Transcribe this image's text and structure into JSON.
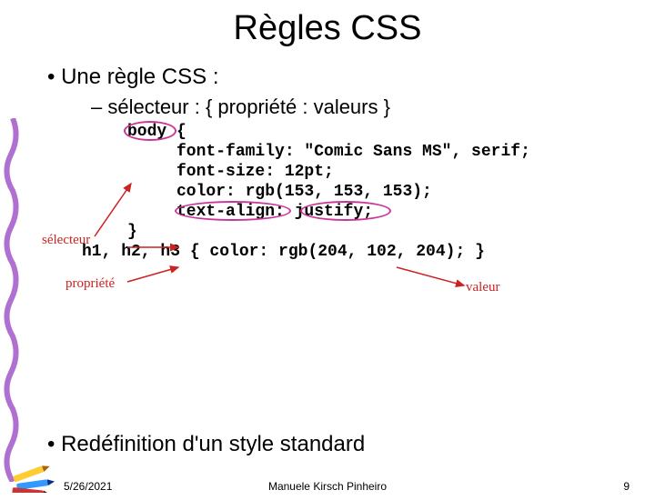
{
  "title": "Règles CSS",
  "bullets": {
    "b1": "• Une règle CSS :",
    "b2": "– sélecteur : { propriété : valeurs }",
    "b3": "• Redéfinition d'un style standard"
  },
  "code": {
    "l1": "body {",
    "l2": "     font-family: \"Comic Sans MS\", serif;",
    "l3": "     font-size: 12pt;",
    "l4": "     color: rgb(153, 153, 153);",
    "l5": "     text-align: justify;",
    "l6": "}",
    "l7": "h1, h2, h3 { color: rgb(204, 102, 204); }"
  },
  "labels": {
    "selector": "sélecteur",
    "property": "propriété",
    "value": "valeur"
  },
  "footer": {
    "date": "5/26/2021",
    "author": "Manuele Kirsch Pinheiro",
    "page": "9"
  }
}
